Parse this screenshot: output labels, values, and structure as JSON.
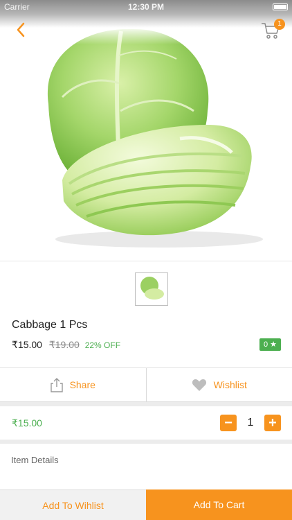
{
  "status_bar": {
    "carrier": "Carrier",
    "time": "12:30 PM"
  },
  "nav": {
    "back_icon": "chevron-left-icon",
    "cart_icon": "cart-icon",
    "cart_count": "1"
  },
  "product": {
    "title": "Cabbage 1 Pcs",
    "price": "₹15.00",
    "mrp": "₹19.00",
    "discount": "22% OFF",
    "rating": "0 ★"
  },
  "actions": {
    "share_label": "Share",
    "wishlist_label": "Wishlist"
  },
  "quantity": {
    "line_price": "₹15.00",
    "minus": "−",
    "value": "1",
    "plus": "+"
  },
  "details": {
    "label": "Item Details"
  },
  "bottom": {
    "add_to_wishlist": "Add To Wihlist",
    "add_to_cart": "Add To Cart"
  },
  "colors": {
    "accent": "#f7931e",
    "success": "#4caf50",
    "cabbage": "#9bd062"
  }
}
